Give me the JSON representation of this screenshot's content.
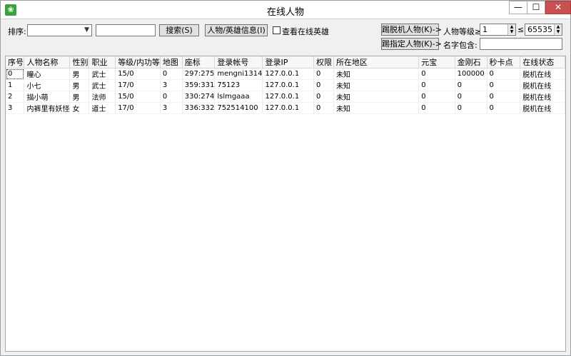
{
  "window": {
    "title": "在线人物",
    "app_icon": "app-icon",
    "minimize_glyph": "—",
    "maximize_glyph": "☐",
    "close_glyph": "✕"
  },
  "toolbar": {
    "sort_label": "排序:",
    "sort_value": "",
    "search_value": "",
    "search_button": "搜索(S)",
    "info_button": "人物/英雄信息(I)",
    "view_heroes_label": "查看在线英雄",
    "view_heroes_checked": false,
    "kick_offline_button": "踢脱机人物(K)->",
    "kick_specific_button": "踢指定人物(K)->",
    "level_label": "人物等级≥",
    "level_min": "1",
    "level_max_sep": "≤",
    "level_max": "65535",
    "name_contains_label": "名字包含:",
    "name_contains_value": ""
  },
  "table": {
    "columns": [
      "序号",
      "人物名称",
      "性别",
      "职业",
      "等级/内功等",
      "地图",
      "座标",
      "登录帐号",
      "登录IP",
      "权限",
      "所在地区",
      "元宝",
      "金刚石",
      "秒卡点",
      "在线状态"
    ],
    "rows": [
      [
        "0",
        "瞳心",
        "男",
        "武士",
        "15/0",
        "0",
        "297:275",
        "mengni1314",
        "127.0.0.1",
        "0",
        "未知",
        "0",
        "100000",
        "0",
        "脱机在线"
      ],
      [
        "1",
        "小七",
        "男",
        "武士",
        "17/0",
        "3",
        "359:331",
        "75123",
        "127.0.0.1",
        "0",
        "未知",
        "0",
        "0",
        "0",
        "脱机在线"
      ],
      [
        "2",
        "描小萌",
        "男",
        "法师",
        "15/0",
        "0",
        "330:274",
        "lslmgaaa",
        "127.0.0.1",
        "0",
        "未知",
        "0",
        "0",
        "0",
        "脱机在线"
      ],
      [
        "3",
        "内裤里有妖怪",
        "女",
        "道士",
        "17/0",
        "3",
        "336:332",
        "752514100",
        "127.0.0.1",
        "0",
        "未知",
        "0",
        "0",
        "0",
        "脱机在线"
      ]
    ]
  }
}
